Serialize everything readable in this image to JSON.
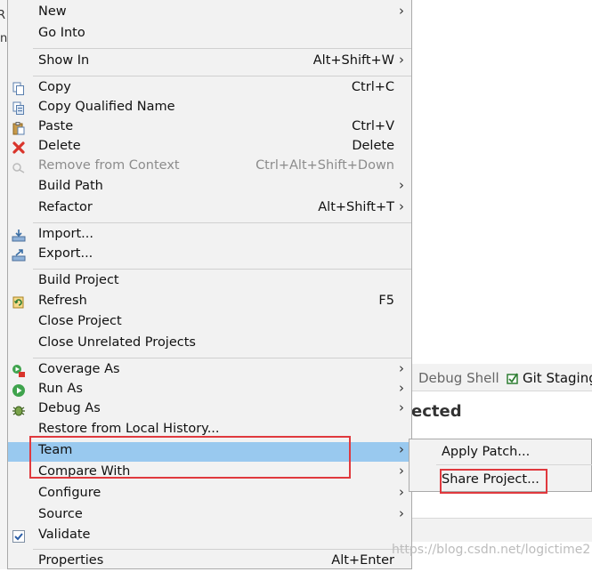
{
  "menu": {
    "items": [
      {
        "label": "New",
        "shortcut": "",
        "submenu": true,
        "icon": "",
        "disabled": false
      },
      {
        "label": "Go Into",
        "shortcut": "",
        "submenu": false,
        "icon": "",
        "disabled": false
      },
      {
        "label": "Show In",
        "shortcut": "Alt+Shift+W",
        "submenu": true,
        "icon": "",
        "disabled": false
      },
      {
        "label": "Copy",
        "shortcut": "Ctrl+C",
        "submenu": false,
        "icon": "copy-icon",
        "disabled": false
      },
      {
        "label": "Copy Qualified Name",
        "shortcut": "",
        "submenu": false,
        "icon": "copy-qualified-name-icon",
        "disabled": false
      },
      {
        "label": "Paste",
        "shortcut": "Ctrl+V",
        "submenu": false,
        "icon": "paste-icon",
        "disabled": false
      },
      {
        "label": "Delete",
        "shortcut": "Delete",
        "submenu": false,
        "icon": "delete-icon",
        "disabled": false
      },
      {
        "label": "Remove from Context",
        "shortcut": "Ctrl+Alt+Shift+Down",
        "submenu": false,
        "icon": "remove-from-context-icon",
        "disabled": true
      },
      {
        "label": "Build Path",
        "shortcut": "",
        "submenu": true,
        "icon": "",
        "disabled": false
      },
      {
        "label": "Refactor",
        "shortcut": "Alt+Shift+T",
        "submenu": true,
        "icon": "",
        "disabled": false
      },
      {
        "label": "Import...",
        "shortcut": "",
        "submenu": false,
        "icon": "import-icon",
        "disabled": false
      },
      {
        "label": "Export...",
        "shortcut": "",
        "submenu": false,
        "icon": "export-icon",
        "disabled": false
      },
      {
        "label": "Build Project",
        "shortcut": "",
        "submenu": false,
        "icon": "",
        "disabled": false
      },
      {
        "label": "Refresh",
        "shortcut": "F5",
        "submenu": false,
        "icon": "refresh-icon",
        "disabled": false
      },
      {
        "label": "Close Project",
        "shortcut": "",
        "submenu": false,
        "icon": "",
        "disabled": false
      },
      {
        "label": "Close Unrelated Projects",
        "shortcut": "",
        "submenu": false,
        "icon": "",
        "disabled": false
      },
      {
        "label": "Coverage As",
        "shortcut": "",
        "submenu": true,
        "icon": "coverage-icon",
        "disabled": false
      },
      {
        "label": "Run As",
        "shortcut": "",
        "submenu": true,
        "icon": "run-icon",
        "disabled": false
      },
      {
        "label": "Debug As",
        "shortcut": "",
        "submenu": true,
        "icon": "debug-bug-icon",
        "disabled": false
      },
      {
        "label": "Restore from Local History...",
        "shortcut": "",
        "submenu": false,
        "icon": "",
        "disabled": false
      },
      {
        "label": "Team",
        "shortcut": "",
        "submenu": true,
        "icon": "",
        "disabled": false,
        "highlighted": true
      },
      {
        "label": "Compare With",
        "shortcut": "",
        "submenu": true,
        "icon": "",
        "disabled": false
      },
      {
        "label": "Configure",
        "shortcut": "",
        "submenu": true,
        "icon": "",
        "disabled": false
      },
      {
        "label": "Source",
        "shortcut": "",
        "submenu": true,
        "icon": "",
        "disabled": false
      },
      {
        "label": "Validate",
        "shortcut": "",
        "submenu": false,
        "icon": "validate-check-icon",
        "disabled": false
      },
      {
        "label": "Properties",
        "shortcut": "Alt+Enter",
        "submenu": false,
        "icon": "",
        "disabled": false
      }
    ]
  },
  "submenu": {
    "items": [
      {
        "label": "Apply Patch..."
      },
      {
        "label": "Share Project..."
      }
    ]
  },
  "background": {
    "tabs": [
      {
        "label": "Debug Shell",
        "active": false
      },
      {
        "label": "Git Staging",
        "active": true
      }
    ],
    "panel_heading_fragment": "ected",
    "left_fragments": [
      "R",
      "n"
    ]
  },
  "watermark": "https://blog.csdn.net/logictime2",
  "colors": {
    "menu_bg": "#f2f2f2",
    "highlight": "#99c9ef",
    "annotation_red": "#e0393e",
    "disabled_text": "#8c8c8c"
  }
}
